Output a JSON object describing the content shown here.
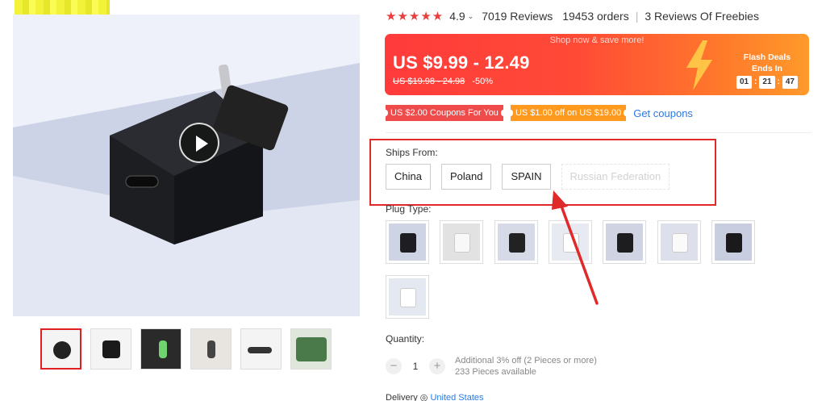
{
  "rating": {
    "stars_icon": "star-icon",
    "value": "4.9",
    "reviews": "7019 Reviews",
    "orders": "19453 orders",
    "freebies": "3 Reviews Of Freebies"
  },
  "price_banner": {
    "top_text": "Shop now & save more!",
    "price_range": "US $9.99 - 12.49",
    "old_price": "US $19.98 - 24.98",
    "discount": "-50%",
    "flash_title": "Flash Deals",
    "ends_in": "Ends In",
    "timer": [
      "01",
      "21",
      "47"
    ],
    "colors": {
      "start": "#ff3b3b",
      "end": "#ff9a2a"
    }
  },
  "coupons": {
    "coupon_1": "US $2.00 Coupons For You",
    "coupon_2": "US $1.00 off on US $19.00",
    "get_coupons": "Get coupons"
  },
  "ships_from": {
    "label": "Ships From:",
    "options": [
      "China",
      "Poland",
      "SPAIN",
      "Russian Federation"
    ]
  },
  "plug_type": {
    "label": "Plug Type:"
  },
  "quantity": {
    "label": "Quantity:",
    "minus": "−",
    "value": "1",
    "plus": "+",
    "discount_note": "Additional 3% off (2 Pieces or more)",
    "available": "233 Pieces available"
  },
  "delivery": {
    "label": "Delivery",
    "location_icon": "location-icon",
    "country": "United States"
  },
  "gallery": {
    "play_icon": "play-icon"
  },
  "accent_colors": {
    "annotation_red": "#e02a2a",
    "link_blue": "#2a7ae2"
  }
}
